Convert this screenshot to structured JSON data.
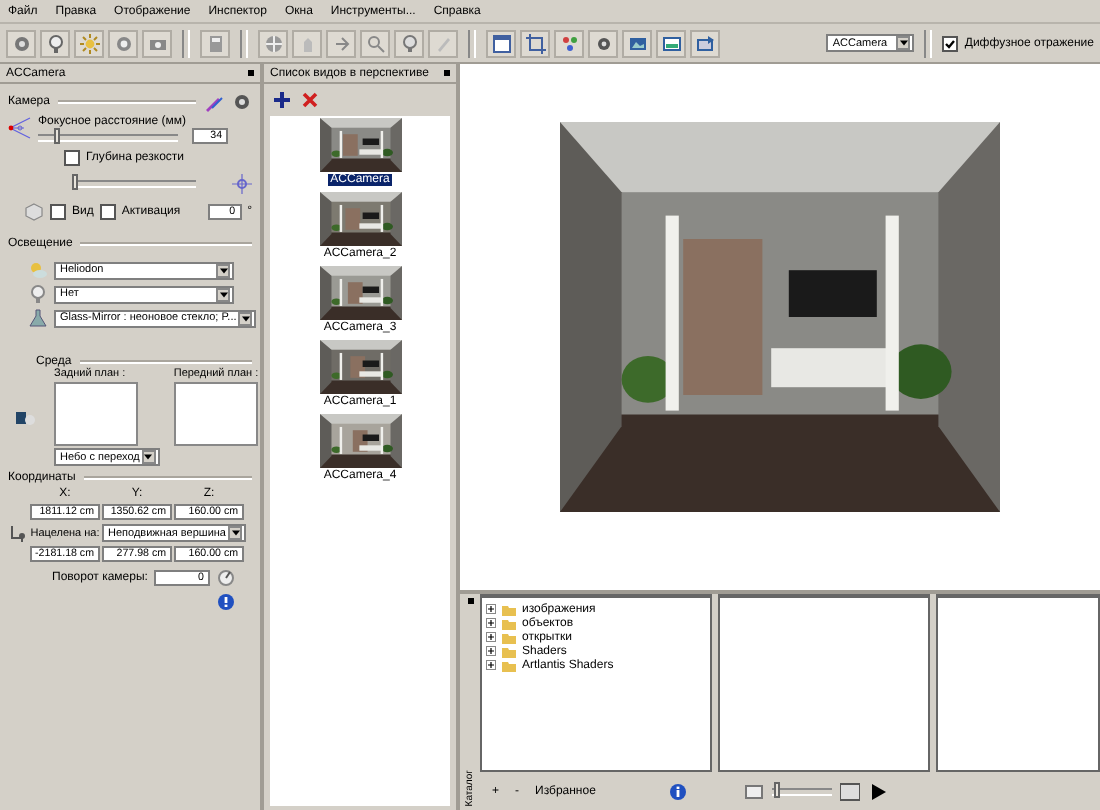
{
  "menu": [
    "Файл",
    "Правка",
    "Отображение",
    "Инспектор",
    "Окна",
    "Инструменты...",
    "Справка"
  ],
  "toolbar": {
    "camera_select": "ACCamera",
    "diffuse": {
      "label": "Диффузное отражение",
      "checked": true
    }
  },
  "inspector": {
    "title": "ACCamera",
    "camera": {
      "heading": "Камера",
      "focal_label": "Фокусное расстояние (мм)",
      "focal": {
        "level": 0.12,
        "value": "34"
      },
      "depth": {
        "label": "Глубина резкости",
        "checked": false,
        "level": 0.0
      },
      "view": {
        "label": "Вид",
        "checked": false
      },
      "activation": {
        "label": "Активация",
        "checked": false
      },
      "angle": "0",
      "degree": "°"
    },
    "lighting": {
      "heading": "Освещение",
      "selects": [
        "Heliodon",
        "Нет",
        "Glass-Mirror : неоновое стекло; P..."
      ]
    },
    "environment": {
      "heading": "Среда",
      "background": "Задний план :",
      "foreground": "Передний план :",
      "sky": "Небо с переход"
    },
    "coordinates": {
      "heading": "Координаты",
      "axes": [
        "X:",
        "Y:",
        "Z:"
      ],
      "position": [
        "1811.12 cm",
        "1350.62 cm",
        "160.00 cm"
      ],
      "target_label": "Нацелена на:",
      "target": "Неподвижная вершина",
      "target_position": [
        "-2181.18 cm",
        "277.98 cm",
        "160.00 cm"
      ],
      "roll_label": "Поворот камеры:",
      "roll": "0"
    }
  },
  "views": {
    "title": "Список видов в перспективе",
    "items": [
      {
        "label": "ACCamera",
        "selected": true
      },
      {
        "label": "ACCamera_2",
        "selected": false
      },
      {
        "label": "ACCamera_3",
        "selected": false
      },
      {
        "label": "ACCamera_1",
        "selected": false
      },
      {
        "label": "ACCamera_4",
        "selected": false
      }
    ]
  },
  "catalog": {
    "label": "Каталог",
    "tree": [
      {
        "label": "изображения",
        "expanded": false
      },
      {
        "label": "объектов",
        "expanded": false
      },
      {
        "label": "открытки",
        "expanded": false
      },
      {
        "label": "Shaders",
        "expanded": false
      },
      {
        "label": "Artlantis Shaders",
        "expanded": false
      }
    ],
    "footer": [
      "+",
      "-",
      "Избранное"
    ],
    "preview": {
      "level": 0.05
    }
  }
}
